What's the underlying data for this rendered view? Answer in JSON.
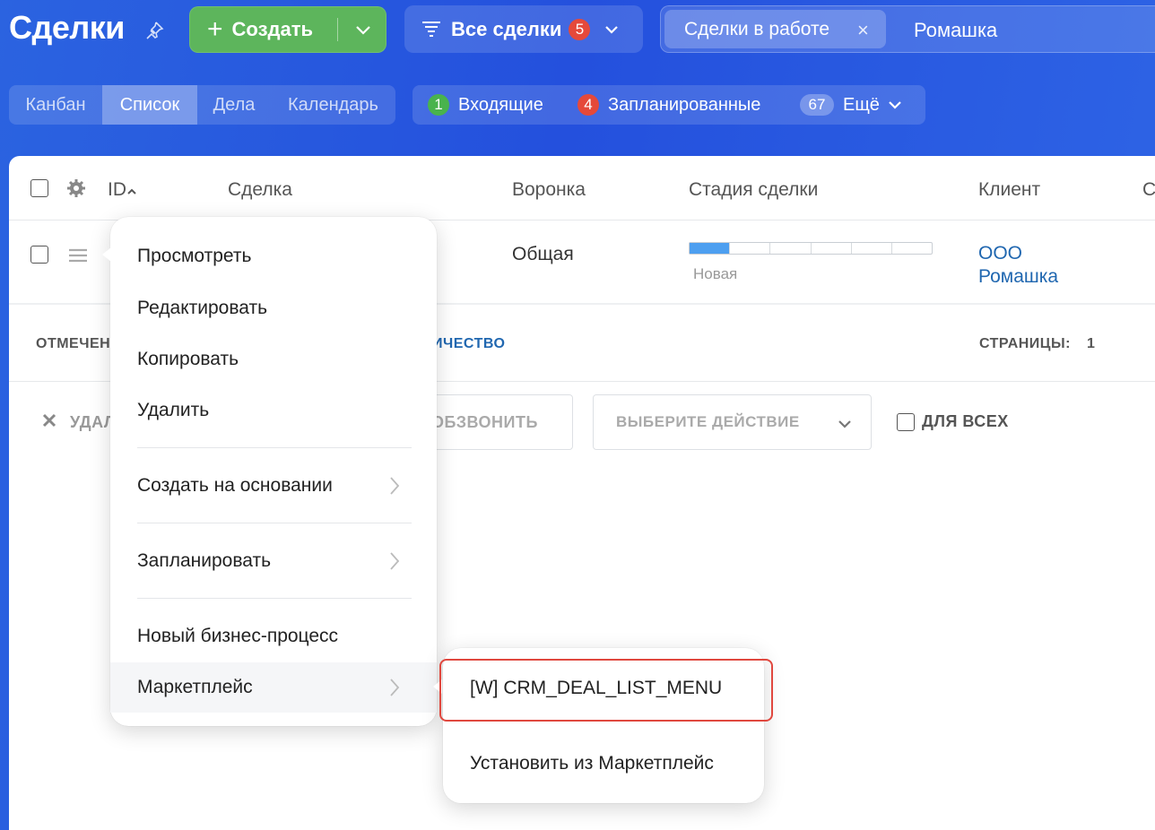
{
  "header": {
    "title": "Сделки",
    "create_label": "Создать",
    "filter_label": "Все сделки",
    "filter_count": "5",
    "chip_label": "Сделки в работе",
    "chip_close": "×",
    "search_value": "Ромашка"
  },
  "views": {
    "tabs": [
      {
        "label": "Канбан"
      },
      {
        "label": "Список"
      },
      {
        "label": "Дела"
      },
      {
        "label": "Календарь"
      }
    ],
    "active": "Список"
  },
  "counters": {
    "incoming_count": "1",
    "incoming_label": "Входящие",
    "planned_count": "4",
    "planned_label": "Запланированные",
    "more_count": "67",
    "more_label": "Ещё"
  },
  "table": {
    "columns": {
      "id": "ID",
      "deal": "Сделка",
      "funnel": "Воронка",
      "stage": "Стадия сделки",
      "client": "Клиент",
      "next": "С"
    },
    "row": {
      "funnel": "Общая",
      "stage_label": "Новая",
      "stage_progress": 0.167,
      "client": "ООО Ромашка"
    },
    "footer": {
      "selected_label": "ОТМЕЧЕН",
      "quantity_label": "ИЧЕСТВО",
      "pages_label": "СТРАНИЦЫ:",
      "pages_value": "1"
    },
    "actions": {
      "delete_label": "УДАЛ",
      "call_label": "ОБЗВОНИТЬ",
      "select_action_label": "ВЫБЕРИТЕ ДЕЙСТВИЕ",
      "for_all_label": "ДЛЯ ВСЕХ"
    }
  },
  "context_menu": {
    "items": [
      {
        "label": "Просмотреть"
      },
      {
        "label": "Редактировать"
      },
      {
        "label": "Копировать"
      },
      {
        "label": "Удалить"
      },
      {
        "label": "Создать на основании"
      },
      {
        "label": "Запланировать"
      },
      {
        "label": "Новый бизнес-процесс"
      },
      {
        "label": "Маркетплейс"
      }
    ]
  },
  "submenu": {
    "items": [
      {
        "label": "[W] CRM_DEAL_LIST_MENU"
      },
      {
        "label": "Установить из Маркетплейс"
      }
    ]
  },
  "colors": {
    "accent_blue": "#2450dd",
    "create_green": "#5db55c",
    "badge_red": "#e5493a",
    "badge_green": "#49b34d",
    "highlight_red": "#e0483f",
    "link_blue": "#2067b0"
  }
}
